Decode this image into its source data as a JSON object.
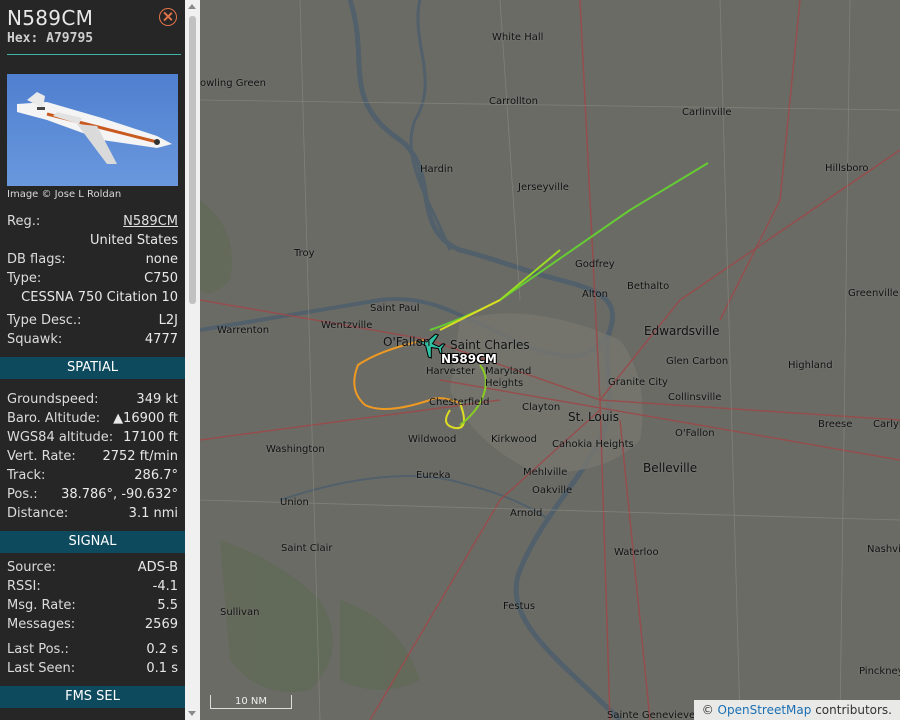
{
  "aircraft": {
    "callsign": "N589CM",
    "hex_label": "Hex:",
    "hex": "A79795",
    "photo_credit": "Image © Jose L Roldan"
  },
  "details": [
    {
      "label": "Reg.:",
      "value": "N589CM",
      "link": true
    },
    {
      "label": "",
      "value": "United States"
    },
    {
      "label": "DB flags:",
      "value": "none"
    },
    {
      "label": "Type:",
      "value": "C750"
    },
    {
      "label": "",
      "value": "CESSNA 750 Citation 10"
    },
    {
      "label": "Type Desc.:",
      "value": "L2J"
    },
    {
      "label": "Squawk:",
      "value": "4777"
    }
  ],
  "sections": {
    "spatial": "SPATIAL",
    "signal": "SIGNAL",
    "fms": "FMS SEL"
  },
  "spatial": [
    {
      "label": "Groundspeed:",
      "value": "349 kt"
    },
    {
      "label": "Baro. Altitude:",
      "value": "▲16900 ft"
    },
    {
      "label": "WGS84 altitude:",
      "value": "17100 ft"
    },
    {
      "label": "Vert. Rate:",
      "value": "2752 ft/min"
    },
    {
      "label": "Track:",
      "value": "286.7°"
    },
    {
      "label": "Pos.:",
      "value": "38.786°, -90.632°"
    },
    {
      "label": "Distance:",
      "value": "3.1 nmi"
    }
  ],
  "signal": [
    {
      "label": "Source:",
      "value": "ADS-B"
    },
    {
      "label": "RSSI:",
      "value": "-4.1"
    },
    {
      "label": "Msg. Rate:",
      "value": "5.5"
    },
    {
      "label": "Messages:",
      "value": "2569"
    },
    {
      "label": "Last Pos.:",
      "value": "0.2 s"
    },
    {
      "label": "Last Seen:",
      "value": "0.1 s"
    }
  ],
  "map": {
    "plane_label": "N589CM",
    "scale": "10 NM",
    "attribution_prefix": "©",
    "attribution_link": "OpenStreetMap",
    "attribution_suffix": "contributors.",
    "places": [
      "White Hall",
      "owling Green",
      "Carrollton",
      "Carlinville",
      "Hardin",
      "Hillsboro",
      "Jerseyville",
      "Troy",
      "Godfrey",
      "Bethalto",
      "Alton",
      "Greenville",
      "Saint Paul",
      "Wentzville",
      "Warrenton",
      "Edwardsville",
      "O'Fallon",
      "Saint Charles",
      "Glen Carbon",
      "Highland",
      "Harvester",
      "Maryland Heights",
      "Granite City",
      "Chesterfield",
      "Clayton",
      "Collinsville",
      "St. Louis",
      "Wildwood",
      "Kirkwood",
      "Cahokia Heights",
      "Breese",
      "Carlyl",
      "Washington",
      "O'Fallon",
      "Belleville",
      "Eureka",
      "Mehlville",
      "Union",
      "Oakville",
      "Arnold",
      "Saint Clair",
      "Waterloo",
      "Nashvil",
      "Festus",
      "Sullivan",
      "Pinckney",
      "Sainte Genevieve"
    ]
  }
}
